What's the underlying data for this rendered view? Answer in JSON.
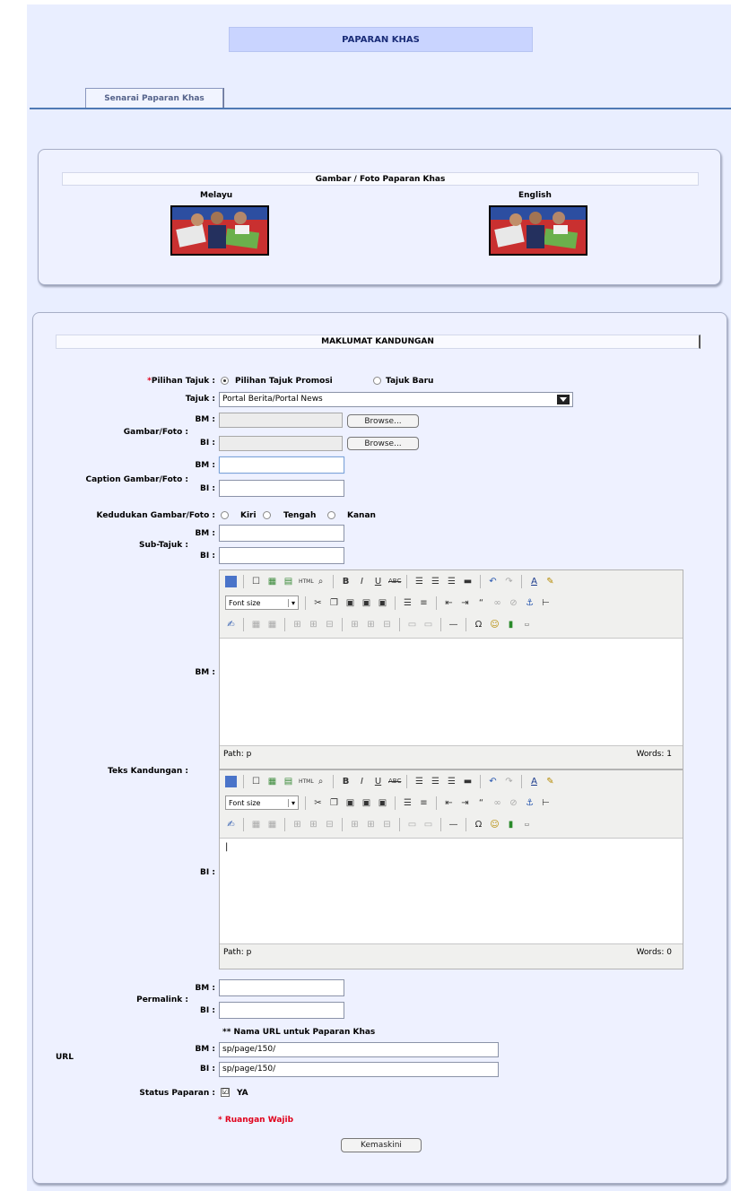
{
  "header": {
    "title": "PAPARAN KHAS"
  },
  "tabs": {
    "list_label": "Senarai Paparan Khas"
  },
  "gallery": {
    "strip_title": "Gambar / Foto Paparan Khas",
    "left_label": "Melayu",
    "right_label": "English"
  },
  "form": {
    "section_title": "MAKLUMAT KANDUNGAN",
    "required_star": "*",
    "pilihan_tajuk_label": "Pilihan Tajuk :",
    "opt_promosi": "Pilihan Tajuk Promosi",
    "opt_baru": "Tajuk Baru",
    "tajuk_label": "Tajuk :",
    "tajuk_value": "Portal Berita/Portal News",
    "gambar_label": "Gambar/Foto :",
    "bm": "BM :",
    "bi": "BI :",
    "browse": "Browse...",
    "caption_label": "Caption Gambar/Foto :",
    "kedudukan_label": "Kedudukan Gambar/Foto :",
    "pos_kiri": "Kiri",
    "pos_tengah": "Tengah",
    "pos_kanan": "Kanan",
    "subtajuk_label": "Sub-Tajuk :",
    "teks_label": "Teks Kandungan :",
    "fontsize": "Font size",
    "path": "Path: p",
    "words_bm": "Words: 1",
    "words_bi": "Words: 0",
    "bi_content": "|",
    "permalink_label": "Permalink :",
    "url_note": "** Nama URL untuk Paparan Khas",
    "url_label": "URL",
    "url_bm_value": "sp/page/150/",
    "url_bi_value": "sp/page/150/",
    "status_label": "Status Paparan :",
    "status_checked": "☑",
    "status_value": "YA",
    "required_note": "* Ruangan Wajib",
    "submit": "Kemaskini"
  },
  "colors": {
    "page_bg": "#e9eeff",
    "title_bg": "#c9d4ff",
    "required": "#e0001b"
  }
}
